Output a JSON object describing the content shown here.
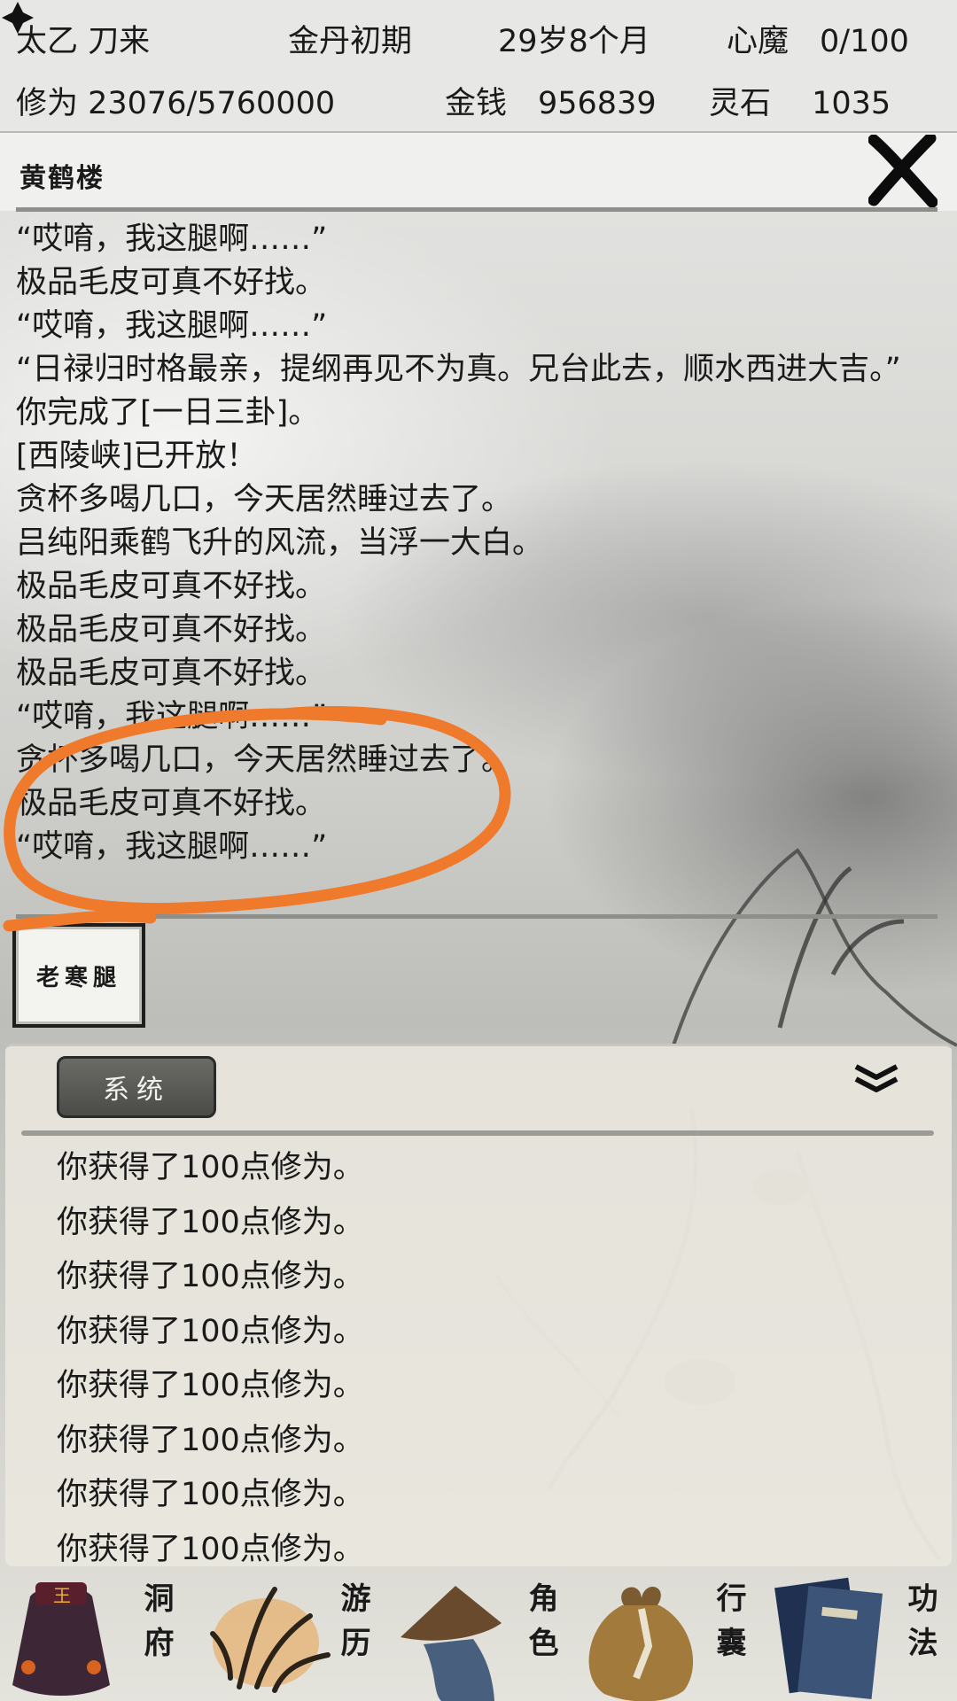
{
  "status": {
    "name": "太乙 刀来",
    "realm": "金丹初期",
    "age": "29岁8个月",
    "demon": "心魔　0/100",
    "cultivation": "修为 23076/5760000",
    "money": "金钱　956839",
    "spirit_stone": "灵石　 1035"
  },
  "location": {
    "title": "黄鹤楼"
  },
  "story_log": [
    "“哎唷，我这腿啊……”",
    "极品毛皮可真不好找。",
    "“哎唷，我这腿啊……”",
    "“日禄归时格最亲，提纲再见不为真。兄台此去，顺水西进大吉。”",
    "你完成了[一日三卦]。",
    "[西陵峡]已开放！",
    "贪杯多喝几口，今天居然睡过去了。",
    "吕纯阳乘鹤飞升的风流，当浮一大白。",
    "极品毛皮可真不好找。",
    "极品毛皮可真不好找。",
    "极品毛皮可真不好找。",
    "“哎唷，我这腿啊……”",
    "贪杯多喝几口，今天居然睡过去了。",
    "极品毛皮可真不好找。",
    "“哎唷，我这腿啊……”"
  ],
  "npc_card": {
    "label": "老寒腿"
  },
  "system": {
    "tab_label": "系统",
    "log": [
      "你获得了100点修为。",
      "你获得了100点修为。",
      "你获得了100点修为。",
      "你获得了100点修为。",
      "你获得了100点修为。",
      "你获得了100点修为。",
      "你获得了100点修为。",
      "你获得了100点修为。"
    ]
  },
  "nav": {
    "cave": "洞府",
    "travel": "游历",
    "character": "角色",
    "bag": "行囊",
    "skills": "功法"
  },
  "icons": {
    "close": "close-x-icon",
    "spirit_stone": "spirit-stone-icon",
    "collapse": "double-chevron-down-icon"
  },
  "colors": {
    "highlight_circle": "#f07a2c",
    "panel_bg": "#e9e7de",
    "tab_bg": "#555551"
  }
}
